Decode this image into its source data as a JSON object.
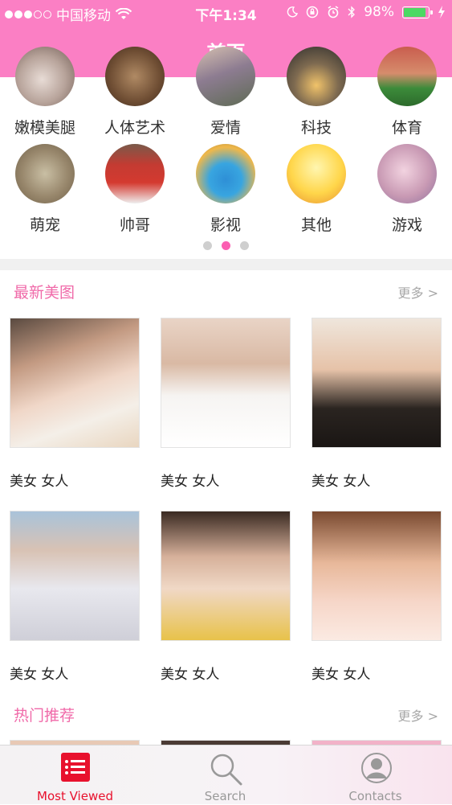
{
  "status_bar": {
    "carrier": "中国移动",
    "time": "下午1:34",
    "battery": "98%",
    "battery_level": 0.98,
    "signal_dots": [
      true,
      true,
      true,
      false,
      false
    ]
  },
  "nav": {
    "title": "首页"
  },
  "categories_row1": [
    "嫩模美腿",
    "人体艺术",
    "爱情",
    "科技",
    "体育"
  ],
  "categories_row2": [
    "萌宠",
    "帅哥",
    "影视",
    "其他",
    "游戏"
  ],
  "pager": {
    "count": 3,
    "active": 1
  },
  "section_latest": {
    "title": "最新美图",
    "more": "更多 >",
    "items": [
      "美女 女人",
      "美女 女人",
      "美女 女人",
      "美女 女人",
      "美女 女人",
      "美女 女人"
    ]
  },
  "section_hot": {
    "title": "热门推荐",
    "more": "更多 >"
  },
  "tabs": [
    {
      "label": "Most Viewed",
      "icon": "list-icon",
      "active": true
    },
    {
      "label": "Search",
      "icon": "search-icon",
      "active": false
    },
    {
      "label": "Contacts",
      "icon": "contacts-icon",
      "active": false
    }
  ],
  "colors": {
    "header": "#fb7fc4",
    "accent_pink": "#f06aa9",
    "tab_active": "#e8112d"
  }
}
